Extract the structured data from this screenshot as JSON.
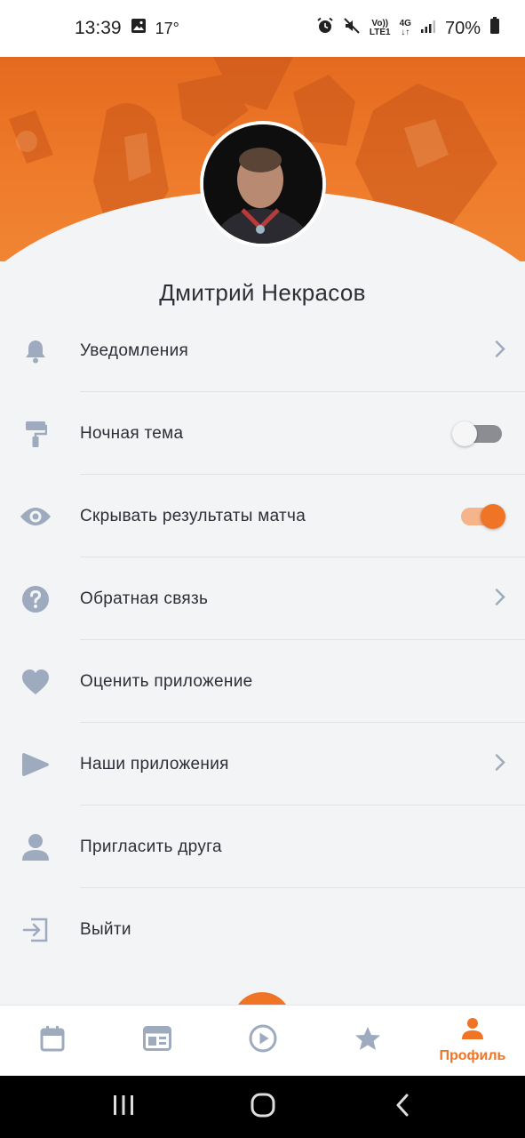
{
  "status_bar": {
    "time": "13:39",
    "temperature": "17°",
    "volte_top": "Vo))",
    "volte_bottom": "LTE1",
    "network": "4G",
    "battery": "70%"
  },
  "profile": {
    "name": "Дмитрий Некрасов"
  },
  "menu": {
    "items": [
      {
        "label": "Уведомления",
        "icon": "bell-icon",
        "trailing": "chevron"
      },
      {
        "label": "Ночная тема",
        "icon": "paint-roller-icon",
        "trailing": "toggle",
        "toggle_on": false
      },
      {
        "label": "Скрывать результаты матча",
        "icon": "eye-icon",
        "trailing": "toggle",
        "toggle_on": true
      },
      {
        "label": "Обратная связь",
        "icon": "help-circle-icon",
        "trailing": "chevron"
      },
      {
        "label": "Оценить приложение",
        "icon": "heart-icon",
        "trailing": "none"
      },
      {
        "label": "Наши приложения",
        "icon": "play-icon",
        "trailing": "chevron"
      },
      {
        "label": "Пригласить друга",
        "icon": "person-icon",
        "trailing": "none"
      },
      {
        "label": "Выйти",
        "icon": "logout-icon",
        "trailing": "none"
      }
    ]
  },
  "bottom_nav": {
    "items": [
      {
        "icon": "calendar-icon",
        "label": ""
      },
      {
        "icon": "news-icon",
        "label": ""
      },
      {
        "icon": "play-circle-icon",
        "label": ""
      },
      {
        "icon": "star-icon",
        "label": ""
      },
      {
        "icon": "profile-icon",
        "label": "Профиль",
        "active": true
      }
    ]
  },
  "colors": {
    "accent": "#f07426",
    "icon_gray": "#9eabbf",
    "background": "#f3f4f6"
  }
}
